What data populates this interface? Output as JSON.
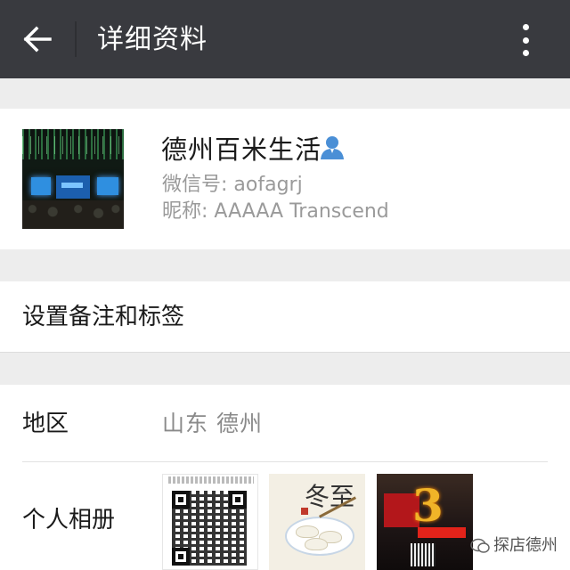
{
  "header": {
    "title": "详细资料"
  },
  "profile": {
    "name": "德州百米生活",
    "wechat_id": "微信号: aofagrj",
    "nickname": "昵称: AAAAA  Transcend"
  },
  "remark": {
    "label": "设置备注和标签"
  },
  "info": {
    "region_label": "地区",
    "region_value": "山东  德州",
    "album_label": "个人相册",
    "album_thumbs": [
      {
        "name": "qr-code-poster",
        "char": ""
      },
      {
        "name": "dumpling-poster",
        "char": "冬至"
      },
      {
        "name": "anniversary-poster",
        "char": "3"
      }
    ]
  },
  "watermark": {
    "text": "探店德州"
  },
  "colors": {
    "topbar": "#393a3f",
    "background": "#ededed",
    "profile_icon": "#4a8fd6"
  }
}
